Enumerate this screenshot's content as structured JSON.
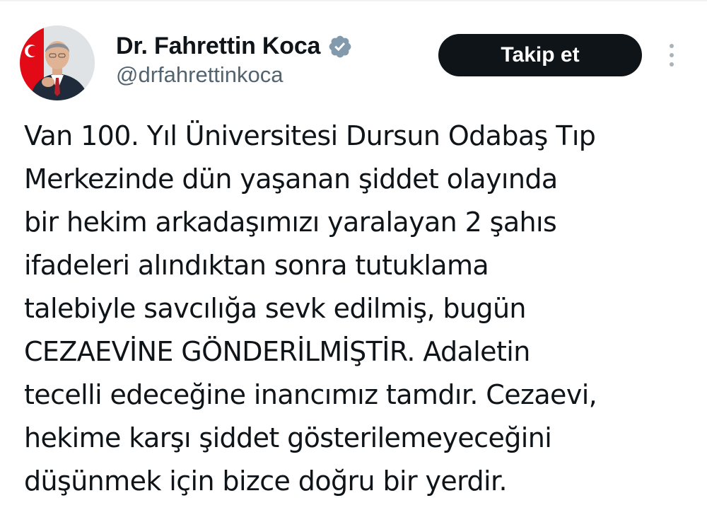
{
  "tweet": {
    "author": {
      "display_name": "Dr. Fahrettin Koca",
      "handle": "@drfahrettinkoca",
      "verified": true,
      "verified_icon": "verified-badge-icon",
      "avatar_icon": "profile-avatar"
    },
    "follow_label": "Takip et",
    "more_icon": "more-vertical-icon",
    "text_lines": [
      "Van 100. Yıl Üniversitesi Dursun Odabaş Tıp",
      "Merkezinde dün yaşanan şiddet olayında",
      "bir hekim arkadaşımızı yaralayan 2 şahıs",
      "ifadeleri alındıktan sonra tutuklama",
      "talebiyle savcılığa sevk edilmiş, bugün",
      "CEZAEVİNE GÖNDERİLMİŞTİR. Adaletin",
      "tecelli edeceğine inancımız tamdır. Cezaevi,",
      "hekime karşı şiddet gösterilemeyeceğini",
      "düşünmek için bizce doğru bir yerdir."
    ]
  },
  "colors": {
    "text_primary": "#0f1419",
    "text_secondary": "#536471",
    "button_bg": "#0f1419",
    "button_text": "#ffffff",
    "verified_badge": "#829aab",
    "flag_red": "#e30a17"
  }
}
